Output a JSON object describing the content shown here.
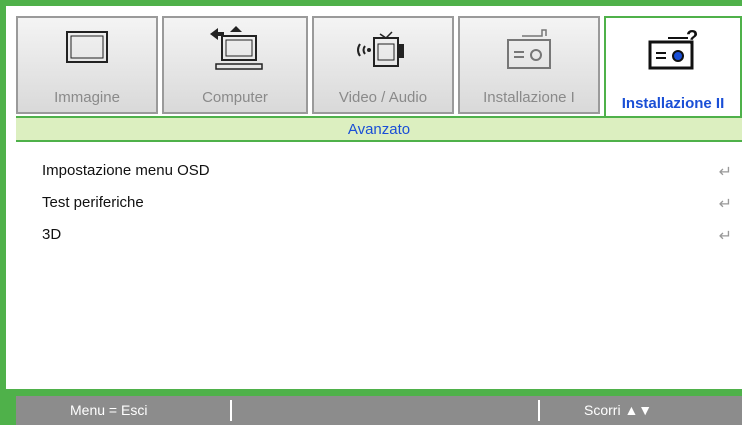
{
  "tabs": [
    {
      "label": "Immagine",
      "icon": "monitor-icon"
    },
    {
      "label": "Computer",
      "icon": "computer-icon"
    },
    {
      "label": "Video / Audio",
      "icon": "video-audio-icon"
    },
    {
      "label": "Installazione I",
      "icon": "projector-icon"
    },
    {
      "label": "Installazione II",
      "icon": "projector-help-icon",
      "active": true
    }
  ],
  "section_title": "Avanzato",
  "menu_items": [
    {
      "label": "Impostazione menu OSD",
      "action_icon": "enter-arrow-icon"
    },
    {
      "label": "Test periferiche",
      "action_icon": "enter-arrow-icon"
    },
    {
      "label": "3D",
      "action_icon": "enter-arrow-icon"
    }
  ],
  "footer": {
    "left": "Menu = Esci",
    "right": "Scorri ▲▼"
  },
  "colors": {
    "frame": "#4fb14a",
    "active_label": "#1a4fd6",
    "section_bg": "#dcefc0",
    "footer_bg": "#8c8c8c"
  }
}
